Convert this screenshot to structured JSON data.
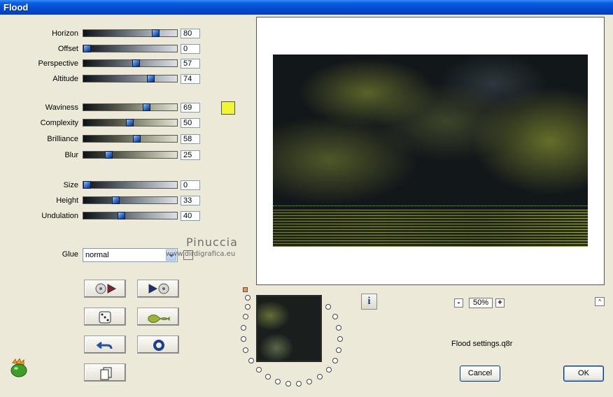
{
  "window": {
    "title": "Flood"
  },
  "groups": {
    "horizon": [
      {
        "label": "Horizon",
        "value": "80"
      },
      {
        "label": "Offset",
        "value": "0"
      },
      {
        "label": "Perspective",
        "value": "57"
      },
      {
        "label": "Altitude",
        "value": "74"
      }
    ],
    "waves": [
      {
        "label": "Waviness",
        "value": "69"
      },
      {
        "label": "Complexity",
        "value": "50"
      },
      {
        "label": "Brilliance",
        "value": "58"
      },
      {
        "label": "Blur",
        "value": "25"
      }
    ],
    "ripple": [
      {
        "label": "Size",
        "value": "0"
      },
      {
        "label": "Height",
        "value": "33"
      },
      {
        "label": "Undulation",
        "value": "40"
      }
    ]
  },
  "glue": {
    "label": "Glue",
    "value": "normal"
  },
  "color_swatch": "#f0f534",
  "watermark": {
    "name": "Pinuccia",
    "url": "www.dirdigrafica.eu"
  },
  "info_button_icon": "i",
  "zoom": {
    "minus": "-",
    "value": "50%",
    "plus": "+"
  },
  "up_icon": "^",
  "settings_file": "Flood settings.q8r",
  "buttons": {
    "cancel": "Cancel",
    "ok": "OK"
  }
}
